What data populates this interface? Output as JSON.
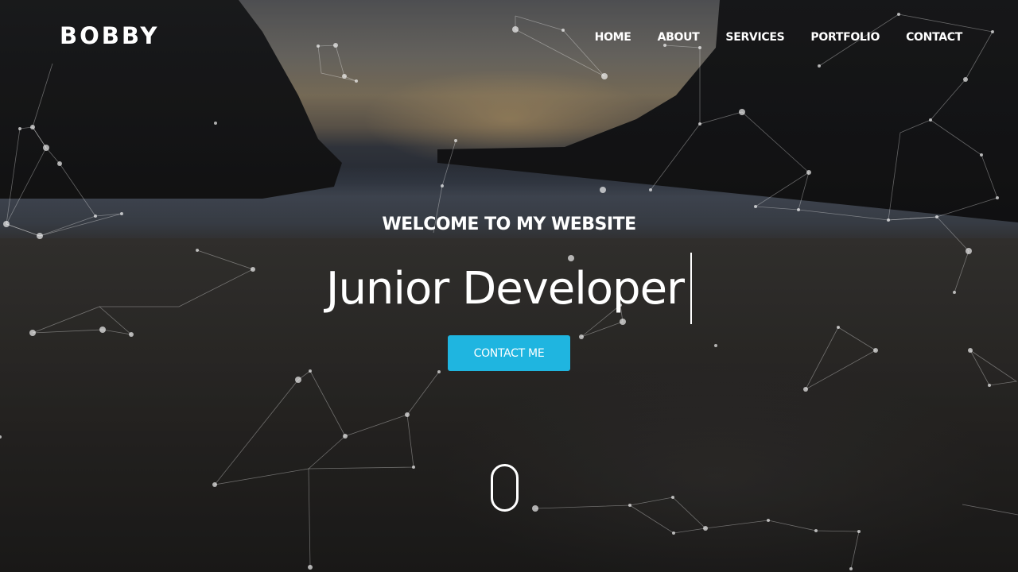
{
  "brand": {
    "logo": "BOBBY"
  },
  "nav": {
    "items": [
      {
        "label": "HOME"
      },
      {
        "label": "ABOUT"
      },
      {
        "label": "SERVICES"
      },
      {
        "label": "PORTFOLIO"
      },
      {
        "label": "CONTACT"
      }
    ]
  },
  "hero": {
    "welcome": "WELCOME TO MY WEBSITE",
    "typed_text": "Junior Developer",
    "cta_label": "CONTACT ME"
  },
  "colors": {
    "accent": "#1fb5e0",
    "text": "#ffffff"
  },
  "icons": {
    "scroll": "mouse-scroll-icon",
    "cursor": "text-cursor"
  }
}
